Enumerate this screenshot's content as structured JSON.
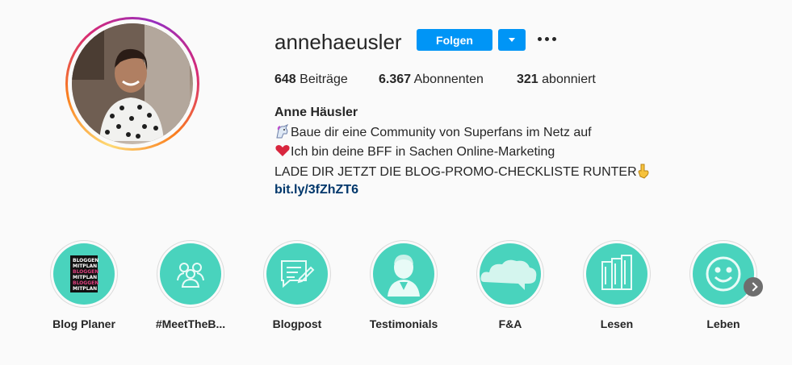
{
  "profile": {
    "username": "annehaeusler",
    "follow_label": "Folgen",
    "full_name": "Anne Häusler",
    "stats": {
      "posts_count": "648",
      "posts_label": "Beiträge",
      "followers_count": "6.367",
      "followers_label": "Abonnenten",
      "following_count": "321",
      "following_label": "abonniert"
    },
    "bio": {
      "line1": "Baue dir eine Community von Superfans im Netz auf",
      "line2": "Ich bin deine BFF in Sachen Online-Marketing",
      "line3": "LADE DIR JETZT DIE BLOG-PROMO-CHECKLISTE RUNTER",
      "link": "bit.ly/3fZhZT6"
    }
  },
  "highlights": [
    {
      "label": "Blog Planer",
      "icon": "planner-book-icon"
    },
    {
      "label": "#MeetTheB...",
      "icon": "people-group-icon"
    },
    {
      "label": "Blogpost",
      "icon": "speech-bubble-pen-icon"
    },
    {
      "label": "Testimonials",
      "icon": "person-icon"
    },
    {
      "label": "F&A",
      "icon": "cloud-icon"
    },
    {
      "label": "Lesen",
      "icon": "books-icon"
    },
    {
      "label": "Leben",
      "icon": "smiley-icon"
    }
  ],
  "colors": {
    "accent": "#0095f6",
    "highlight_bg": "#49d3bd",
    "link": "#00376b"
  }
}
